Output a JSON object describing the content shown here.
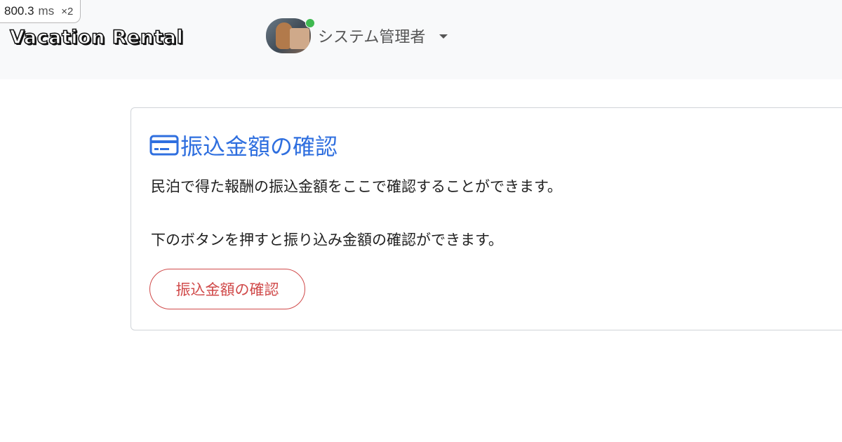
{
  "perf": {
    "value": "800.3",
    "unit": "ms",
    "multiplier": "×2"
  },
  "navbar": {
    "brand": "Vacation Rental",
    "user": {
      "name": "システム管理者",
      "status_color": "#3fb950"
    }
  },
  "card": {
    "title": "振込金額の確認",
    "description": "民泊で得た報酬の振込金額をここで確認することができます。",
    "instruction": "下のボタンを押すと振り込み金額の確認ができます。",
    "button_label": "振込金額の確認",
    "accent_color": "#2f6fdf",
    "button_color": "#d04a4a"
  }
}
